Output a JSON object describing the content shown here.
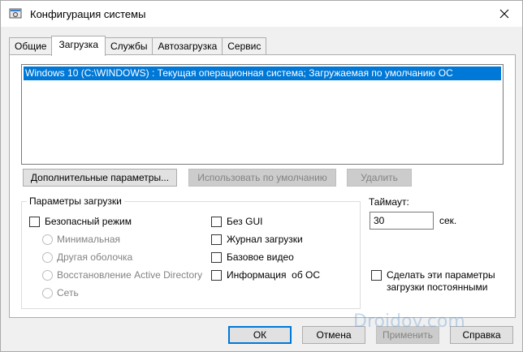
{
  "window": {
    "title": "Конфигурация системы",
    "icon": "msconfig-icon"
  },
  "tabs": [
    {
      "label": "Общие",
      "active": false
    },
    {
      "label": "Загрузка",
      "active": true
    },
    {
      "label": "Службы",
      "active": false
    },
    {
      "label": "Автозагрузка",
      "active": false
    },
    {
      "label": "Сервис",
      "active": false
    }
  ],
  "os_list": {
    "items": [
      "Windows 10 (C:\\WINDOWS) : Текущая операционная система; Загружаемая по умолчанию ОС"
    ],
    "selected_index": 0
  },
  "list_buttons": {
    "advanced": "Дополнительные параметры...",
    "set_default": "Использовать по умолчанию",
    "delete": "Удалить"
  },
  "boot_options": {
    "group_label": "Параметры загрузки",
    "safe_boot": {
      "label": "Безопасный режим",
      "checked": false
    },
    "safe_modes": [
      {
        "label": "Минимальная",
        "selected": false
      },
      {
        "label": "Другая оболочка",
        "selected": false
      },
      {
        "label": "Восстановление Active Directory",
        "selected": false
      },
      {
        "label": "Сеть",
        "selected": false
      }
    ],
    "no_gui": {
      "label": "Без GUI",
      "checked": false
    },
    "boot_log": {
      "label": "Журнал загрузки",
      "checked": false
    },
    "base_video": {
      "label": "Базовое видео",
      "checked": false
    },
    "os_boot_info": {
      "label": "Информация  об ОС",
      "checked": false
    }
  },
  "timeout": {
    "label": "Таймаут:",
    "value": "30",
    "unit": "сек."
  },
  "make_permanent": {
    "label_line1": "Сделать эти параметры",
    "label_line2": "загрузки постоянными",
    "checked": false
  },
  "dialog_buttons": {
    "ok": "ОК",
    "cancel": "Отмена",
    "apply": "Применить",
    "help": "Справка"
  },
  "watermark": "Droidov.com",
  "colors": {
    "selection": "#0078d7",
    "window_bg": "#f0f0f0",
    "disabled_text": "#838383"
  }
}
